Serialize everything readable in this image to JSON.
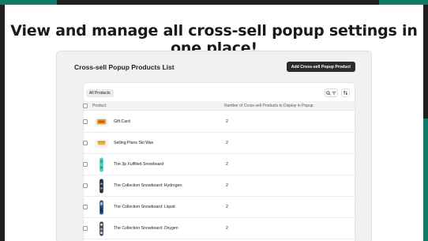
{
  "headline": "View and manage all cross-sell popup settings in one place!",
  "panel": {
    "title": "Cross-sell Popup Products List",
    "add_button": "Add Cross-sell Popup Product"
  },
  "tabs": {
    "all": "All Products"
  },
  "toolbar": {
    "search_filter_icon": "search-filter-icon",
    "sort_icon": "sort-icon"
  },
  "table": {
    "columns": [
      "Product",
      "Number of Cross-sell Products to Display in Popup"
    ],
    "rows": [
      {
        "name": "Gift Card",
        "count": "2",
        "thumb": "gift-card"
      },
      {
        "name": "Selling Plans Ski Wax",
        "count": "2",
        "thumb": "ski-wax"
      },
      {
        "name": "The 3p Fulfilled Snowboard",
        "count": "2",
        "thumb": "snowboard-teal"
      },
      {
        "name": "The Collection Snowboard: Hydrogen",
        "count": "2",
        "thumb": "snowboard-dark"
      },
      {
        "name": "The Collection Snowboard: Liquid",
        "count": "2",
        "thumb": "snowboard-blue"
      },
      {
        "name": "The Collection Snowboard: Oxygen",
        "count": "2",
        "thumb": "snowboard-mixed"
      }
    ]
  },
  "colors": {
    "accent": "#0f7a67",
    "button": "#2b2b2b"
  }
}
